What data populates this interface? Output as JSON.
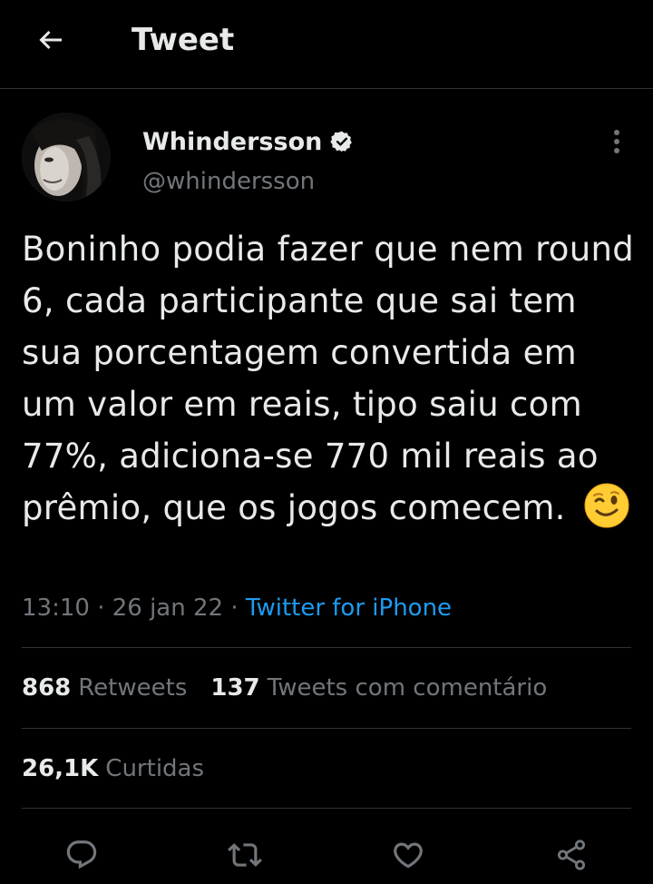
{
  "header": {
    "title": "Tweet",
    "back_icon": "arrow-left-icon"
  },
  "author": {
    "display_name": "Whindersson",
    "handle": "@whindersson",
    "verified": true
  },
  "tweet": {
    "text": "Boninho podia fazer que nem round 6, cada participante que sai tem sua porcentagem convertida em um valor em reais, tipo saiu com 77%, adiciona-se 770 mil reais ao prêmio, que os jogos comecem.",
    "emoji": "winking-face",
    "time": "13:10",
    "separator": "·",
    "date": "26 jan 22",
    "source": "Twitter for iPhone"
  },
  "stats": {
    "retweets_count": "868",
    "retweets_label": "Retweets",
    "quotes_count": "137",
    "quotes_label": "Tweets com comentário",
    "likes_count": "26,1K",
    "likes_label": "Curtidas"
  },
  "actions": [
    {
      "icon": "reply-icon"
    },
    {
      "icon": "retweet-icon"
    },
    {
      "icon": "like-icon"
    },
    {
      "icon": "share-icon"
    }
  ],
  "colors": {
    "background": "#000000",
    "text": "#e7e9ea",
    "secondary": "#71767b",
    "link": "#1d9bf0",
    "divider": "#2f3336"
  }
}
